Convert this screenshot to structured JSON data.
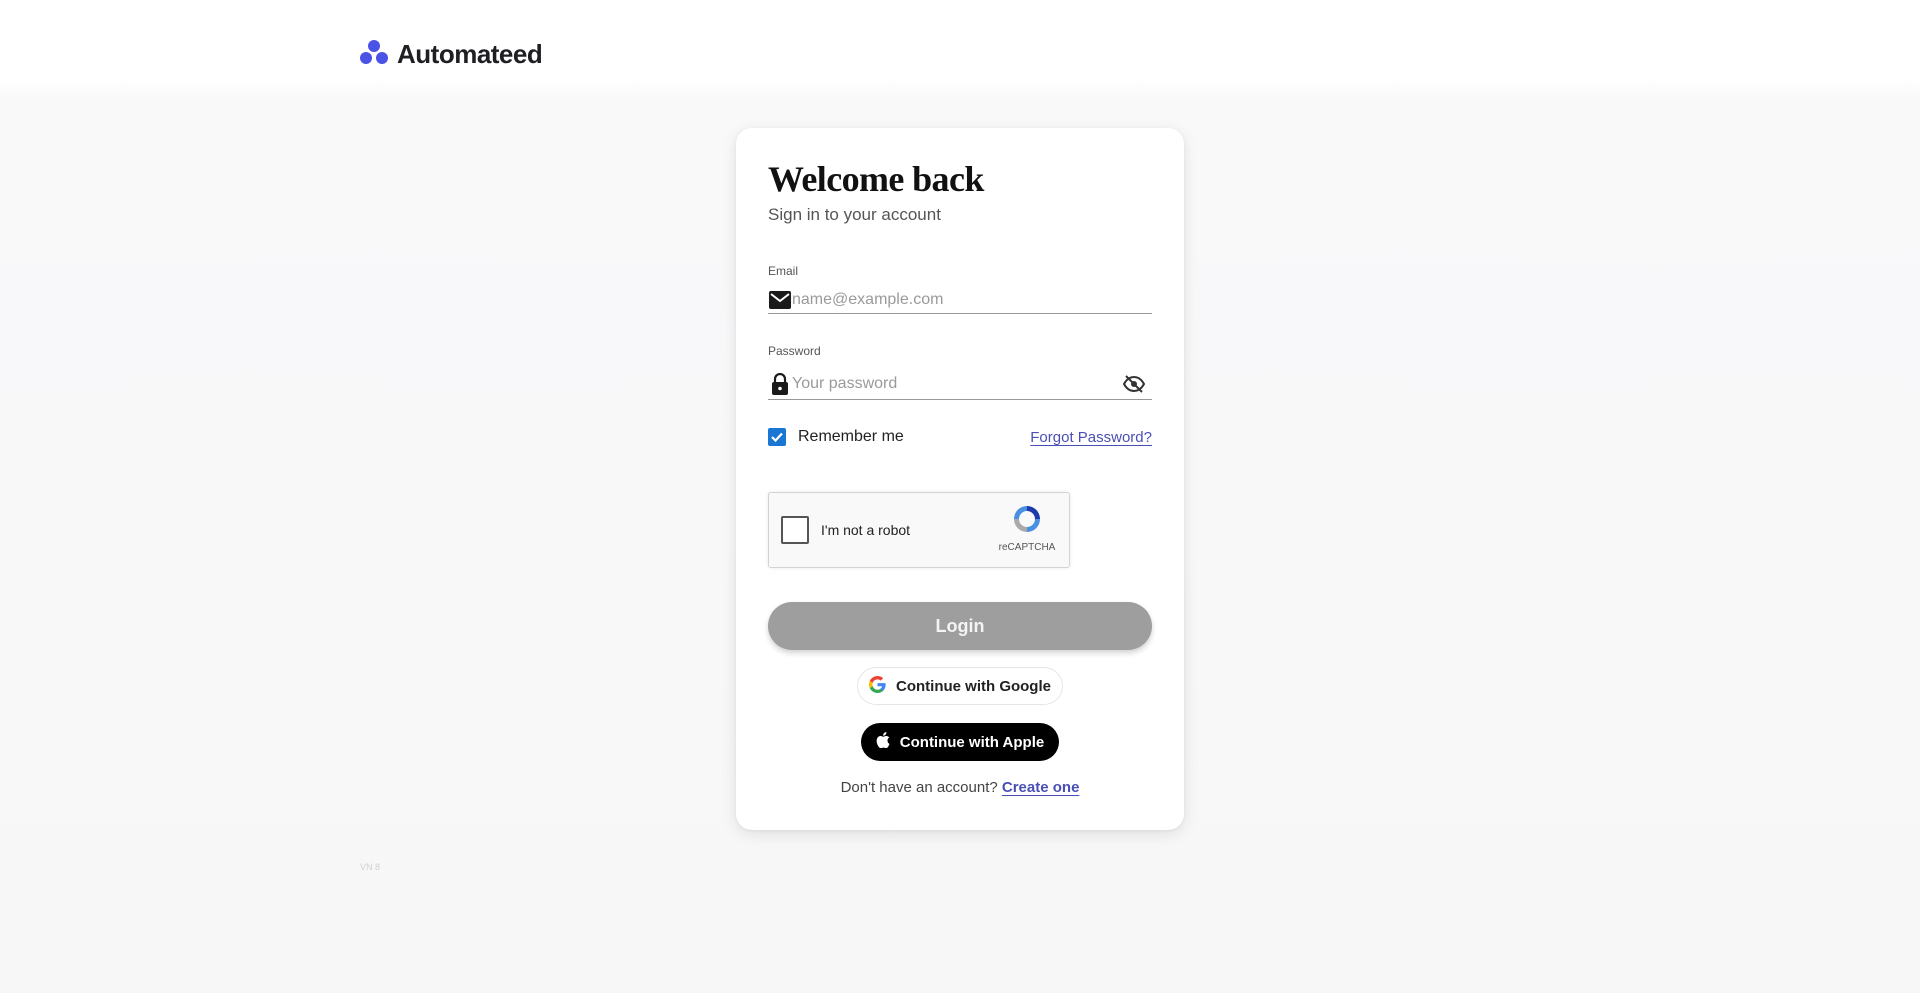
{
  "brand": {
    "name": "Automateed",
    "accent": "#4b52e6"
  },
  "login": {
    "title": "Welcome back",
    "subtitle": "Sign in to your account",
    "email": {
      "label": "Email",
      "placeholder": "name@example.com",
      "value": "",
      "icon": "mail-icon"
    },
    "password": {
      "label": "Password",
      "placeholder": "Your password",
      "value": "",
      "icon": "lock-icon",
      "toggle_icon": "eye-off-icon"
    },
    "remember_me": {
      "label": "Remember me",
      "checked": true,
      "color": "#1976d2"
    },
    "forgot_password": "Forgot Password?",
    "captcha": {
      "label": "I'm not a robot",
      "brand": "reCAPTCHA"
    },
    "login_button": "Login",
    "google_button": "Continue with Google",
    "apple_button": "Continue with Apple",
    "signup_prompt": "Don't have an account?",
    "signup_link": "Create one"
  },
  "footer": {
    "version": "VN 8"
  }
}
